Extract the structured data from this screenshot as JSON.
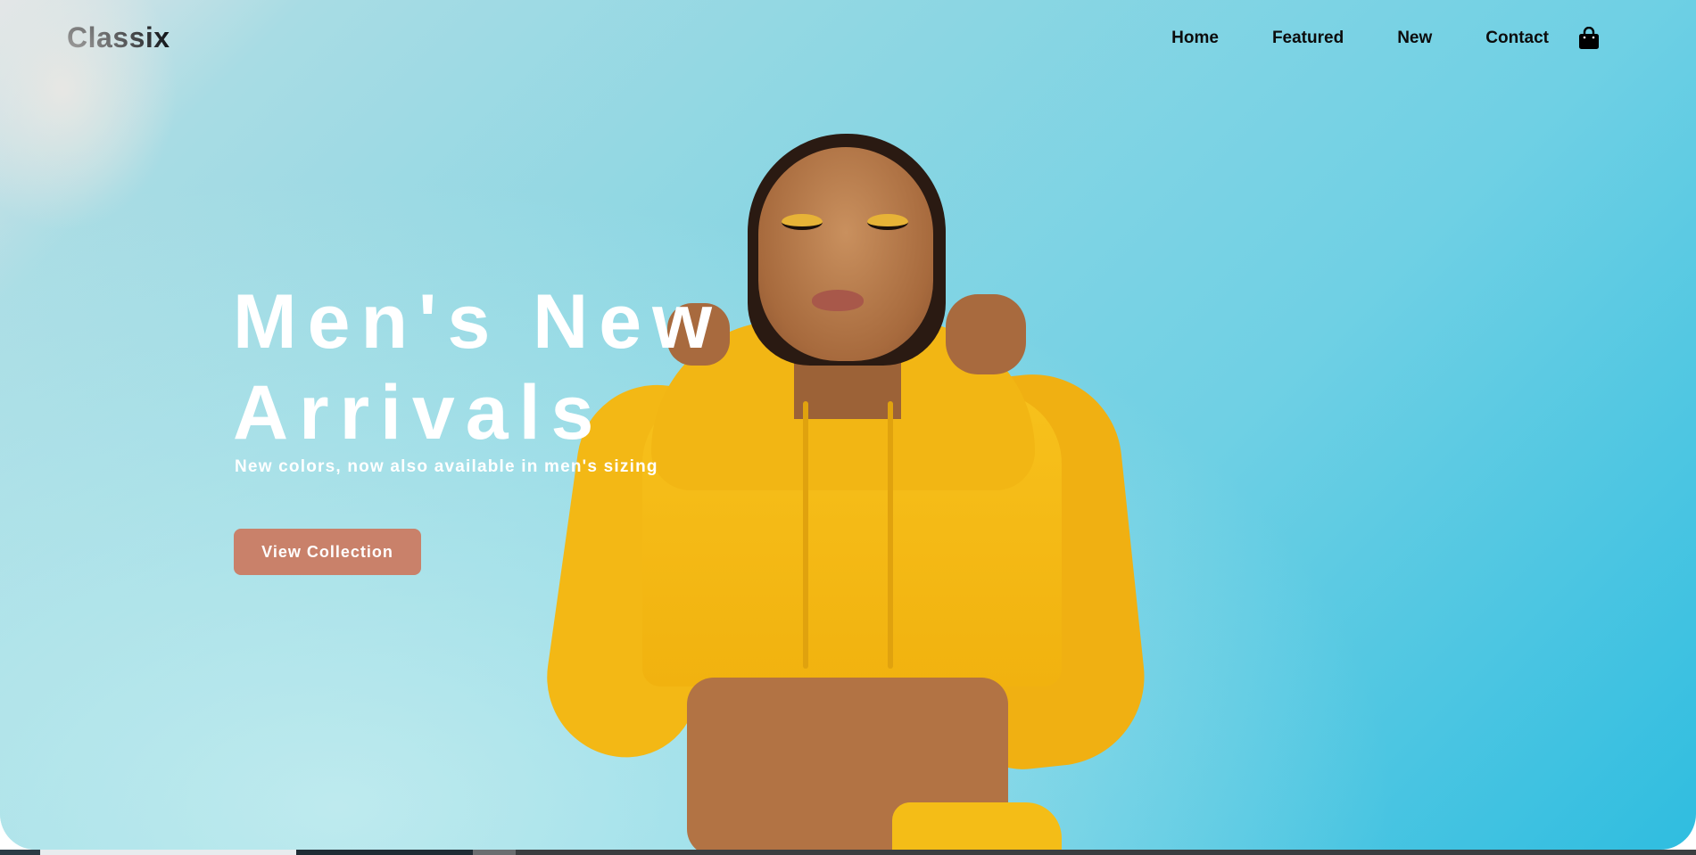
{
  "brand": {
    "name": "Classix"
  },
  "nav": {
    "items": [
      {
        "label": "Home"
      },
      {
        "label": "Featured"
      },
      {
        "label": "New"
      },
      {
        "label": "Contact"
      }
    ],
    "cart_icon": "shopping-bag-icon"
  },
  "hero": {
    "headline_line1": "Men's New",
    "headline_line2": "Arrivals",
    "subheadline": "New colors, now also available in men's sizing",
    "cta_label": "View Collection"
  },
  "colors": {
    "accent": "#c9816a",
    "sky": "#6fd0e4",
    "hoodie": "#f2b614",
    "text_dark": "#0c0c0c",
    "text_light": "#ffffff"
  }
}
